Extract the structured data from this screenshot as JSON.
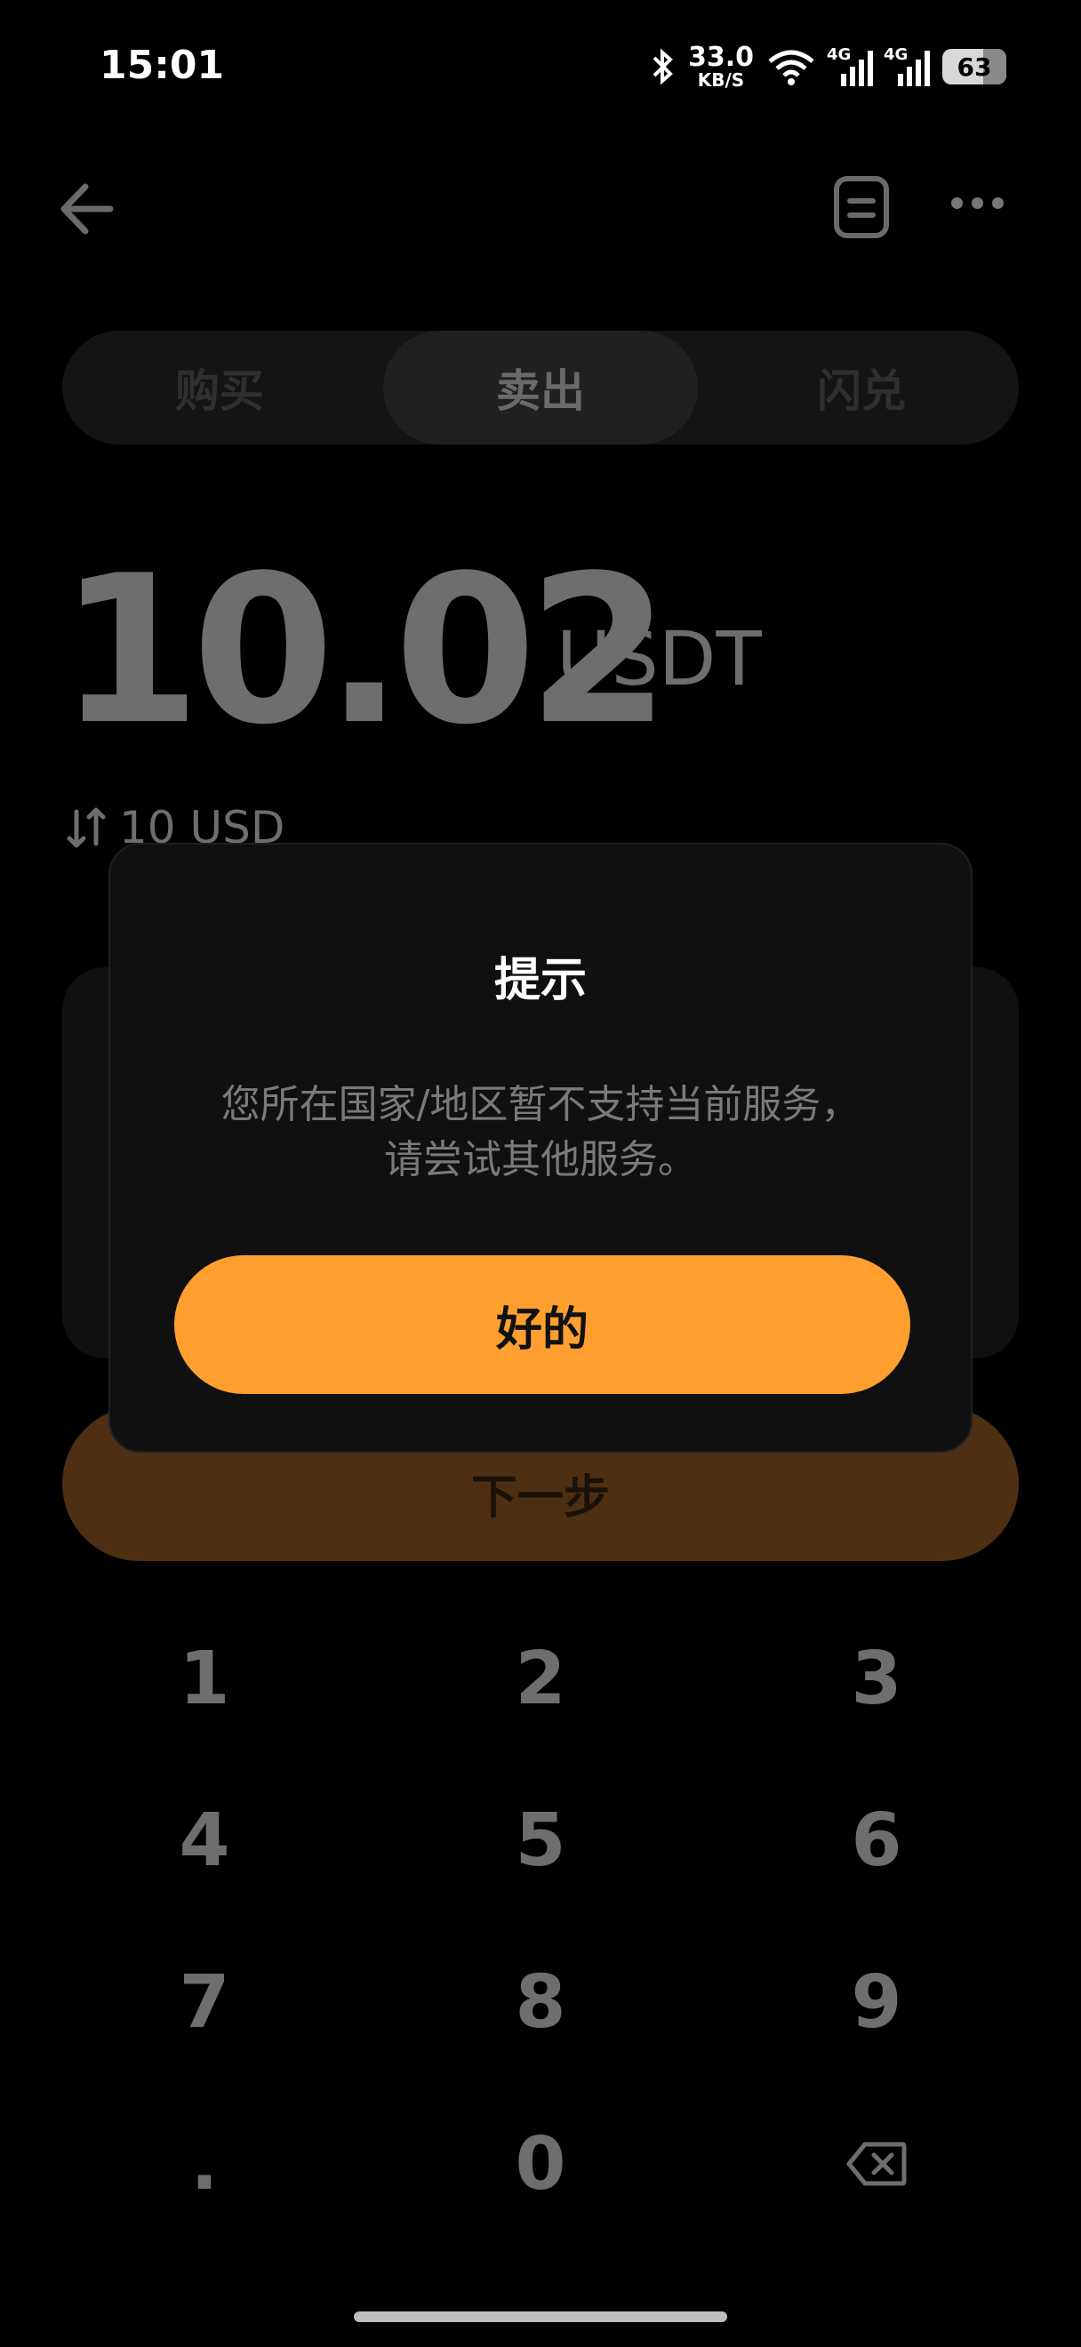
{
  "status_bar": {
    "time": "15:01",
    "speed_value": "33.0",
    "speed_unit": "KB/S",
    "net1": "4G",
    "net2": "4G",
    "battery": "63"
  },
  "tabs": [
    {
      "label": "购买"
    },
    {
      "label": "卖出"
    },
    {
      "label": "闪兑"
    }
  ],
  "amount": {
    "value": "10.02",
    "unit": "USDT",
    "converted": "10 USD"
  },
  "next_button": {
    "label": "下一步"
  },
  "keypad": {
    "k1": "1",
    "k2": "2",
    "k3": "3",
    "k4": "4",
    "k5": "5",
    "k6": "6",
    "k7": "7",
    "k8": "8",
    "k9": "9",
    "dot": ".",
    "k0": "0"
  },
  "dialog": {
    "title": "提示",
    "message": "您所在国家/地区暂不支持当前服务，请尝试其他服务。",
    "ok_label": "好的"
  },
  "colors": {
    "accent": "#ff9f2f",
    "accent_dim": "#4e2f13",
    "background": "#000000"
  }
}
